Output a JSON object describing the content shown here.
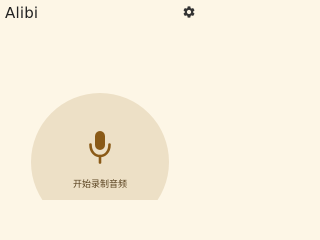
{
  "app": {
    "title": "Alibi"
  },
  "header": {
    "settings_icon": "gear-icon"
  },
  "record": {
    "icon": "microphone-icon",
    "label": "开始录制音频"
  },
  "colors": {
    "background": "#fdf6e6",
    "button_background": "#ede0c6",
    "accent": "#8a5a17",
    "text": "#222222"
  }
}
